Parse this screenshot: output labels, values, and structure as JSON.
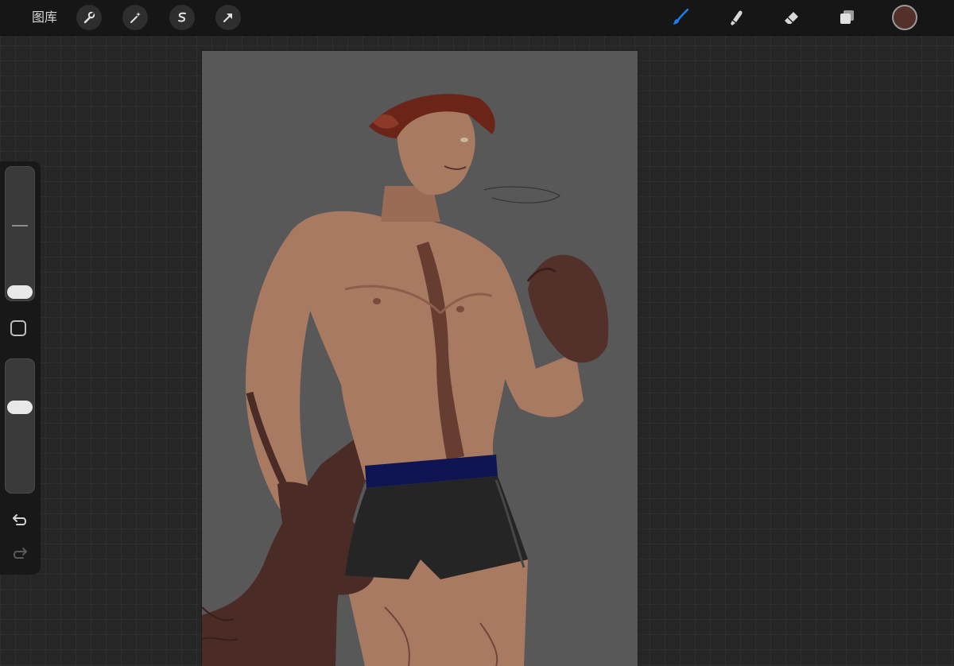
{
  "toolbar": {
    "gallery_label": "图库",
    "left_tools": [
      "wrench-icon",
      "magic-wand-icon",
      "selection-icon",
      "transform-arrow-icon"
    ],
    "right_tools": [
      "brush-icon",
      "smudge-icon",
      "eraser-icon",
      "layers-icon"
    ],
    "active_tool": "brush-icon",
    "active_color": "#54302a"
  },
  "colors": {
    "accent": "#1e7ce8",
    "canvas_bg": "#585858",
    "skin": "#a97a62",
    "hair": "#6b2418",
    "shorts": "#252526",
    "waistband": "#0f1552",
    "glove": "#54302a"
  },
  "sidebar": {
    "brush_size_level": 0.08,
    "opacity_level": 0.6,
    "icons": [
      "modify-square-icon",
      "undo-icon",
      "redo-icon"
    ]
  }
}
